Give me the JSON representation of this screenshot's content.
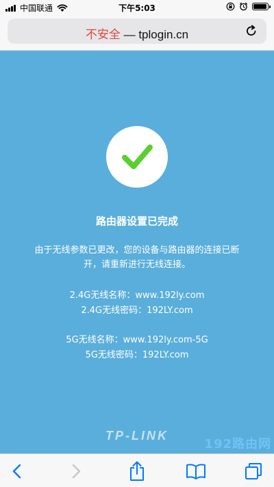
{
  "status_bar": {
    "carrier": "中国联通",
    "time": "下午5:03",
    "battery_level": 0.85,
    "icons": [
      "signal-icon",
      "wifi-icon",
      "lock-rotation-icon",
      "alarm-icon",
      "battery-icon"
    ]
  },
  "address_bar": {
    "insecure_label": "不安全",
    "separator": " — ",
    "domain": "tplogin.cn",
    "reload_icon": "reload-icon"
  },
  "page": {
    "check_icon": "check-icon",
    "title": "路由器设置已完成",
    "message": "由于无线参数已更改，您的设备与路由器的连接已断开，请重新进行无线连接。",
    "wifi_24g_name": "2.4G无线名称：www.192ly.com",
    "wifi_24g_password": "2.4G无线密码：192LY.com",
    "wifi_5g_name": "5G无线名称：www.192ly.com-5G",
    "wifi_5g_password": "5G无线密码：192LY.com",
    "brand": "TP-LINK",
    "watermark": "192路由网"
  },
  "toolbar": {
    "items": [
      "back-icon",
      "forward-icon",
      "share-icon",
      "bookmarks-icon",
      "tabs-icon"
    ]
  },
  "colors": {
    "page_background": "#5aaedb",
    "check_green": "#5bcf2f",
    "insecure_red": "#e0483f",
    "ios_blue": "#007aff"
  }
}
